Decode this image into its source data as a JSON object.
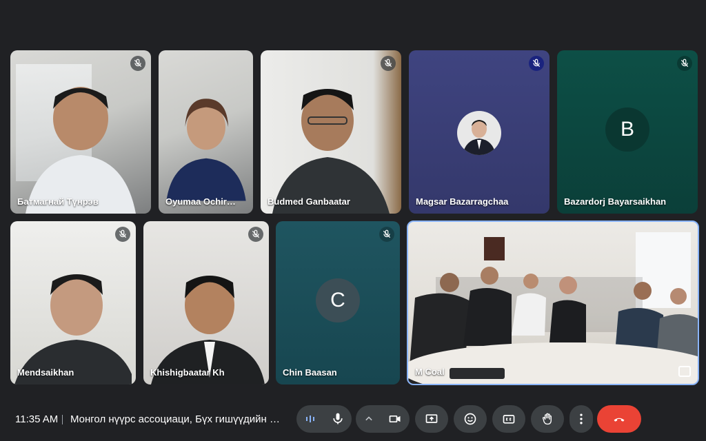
{
  "participants": [
    {
      "name": "Батмагнай Түнрэв",
      "muted": true
    },
    {
      "name": "Oyumaa Ochir…",
      "muted": true
    },
    {
      "name": "Budmed Ganbaatar",
      "muted": true
    },
    {
      "name": "Magsar Bazarragchaa",
      "muted": true
    },
    {
      "name": "Bazardorj Bayarsaikhan",
      "muted": true,
      "initial": "B"
    },
    {
      "name": "Mendsaikhan",
      "muted": true
    },
    {
      "name": "Khishigbaatar Kh",
      "muted": true
    },
    {
      "name": "Chin Baasan",
      "muted": true,
      "initial": "C"
    },
    {
      "name": "M Coal",
      "muted": false,
      "active_speaker": true
    }
  ],
  "footer": {
    "time": "11:35 AM",
    "meeting_title": "Монгол нүүрс ассоциаци, Бүх гишүүдийн х…"
  },
  "controls": [
    {
      "icon": "audio-activity-icon"
    },
    {
      "icon": "microphone-icon"
    },
    {
      "icon": "chevron-up-icon"
    },
    {
      "icon": "camera-icon"
    },
    {
      "icon": "present-screen-icon"
    },
    {
      "icon": "emoji-icon"
    },
    {
      "icon": "captions-icon"
    },
    {
      "icon": "raise-hand-icon"
    },
    {
      "icon": "more-options-icon"
    },
    {
      "icon": "leave-call-icon"
    }
  ],
  "colors": {
    "background": "#202124",
    "control": "#3c4043",
    "leave": "#ea4335",
    "avatar_tile": "#0f4c45",
    "magsar_tile": "#3a3f7a",
    "active_border": "#8ab4f8"
  }
}
